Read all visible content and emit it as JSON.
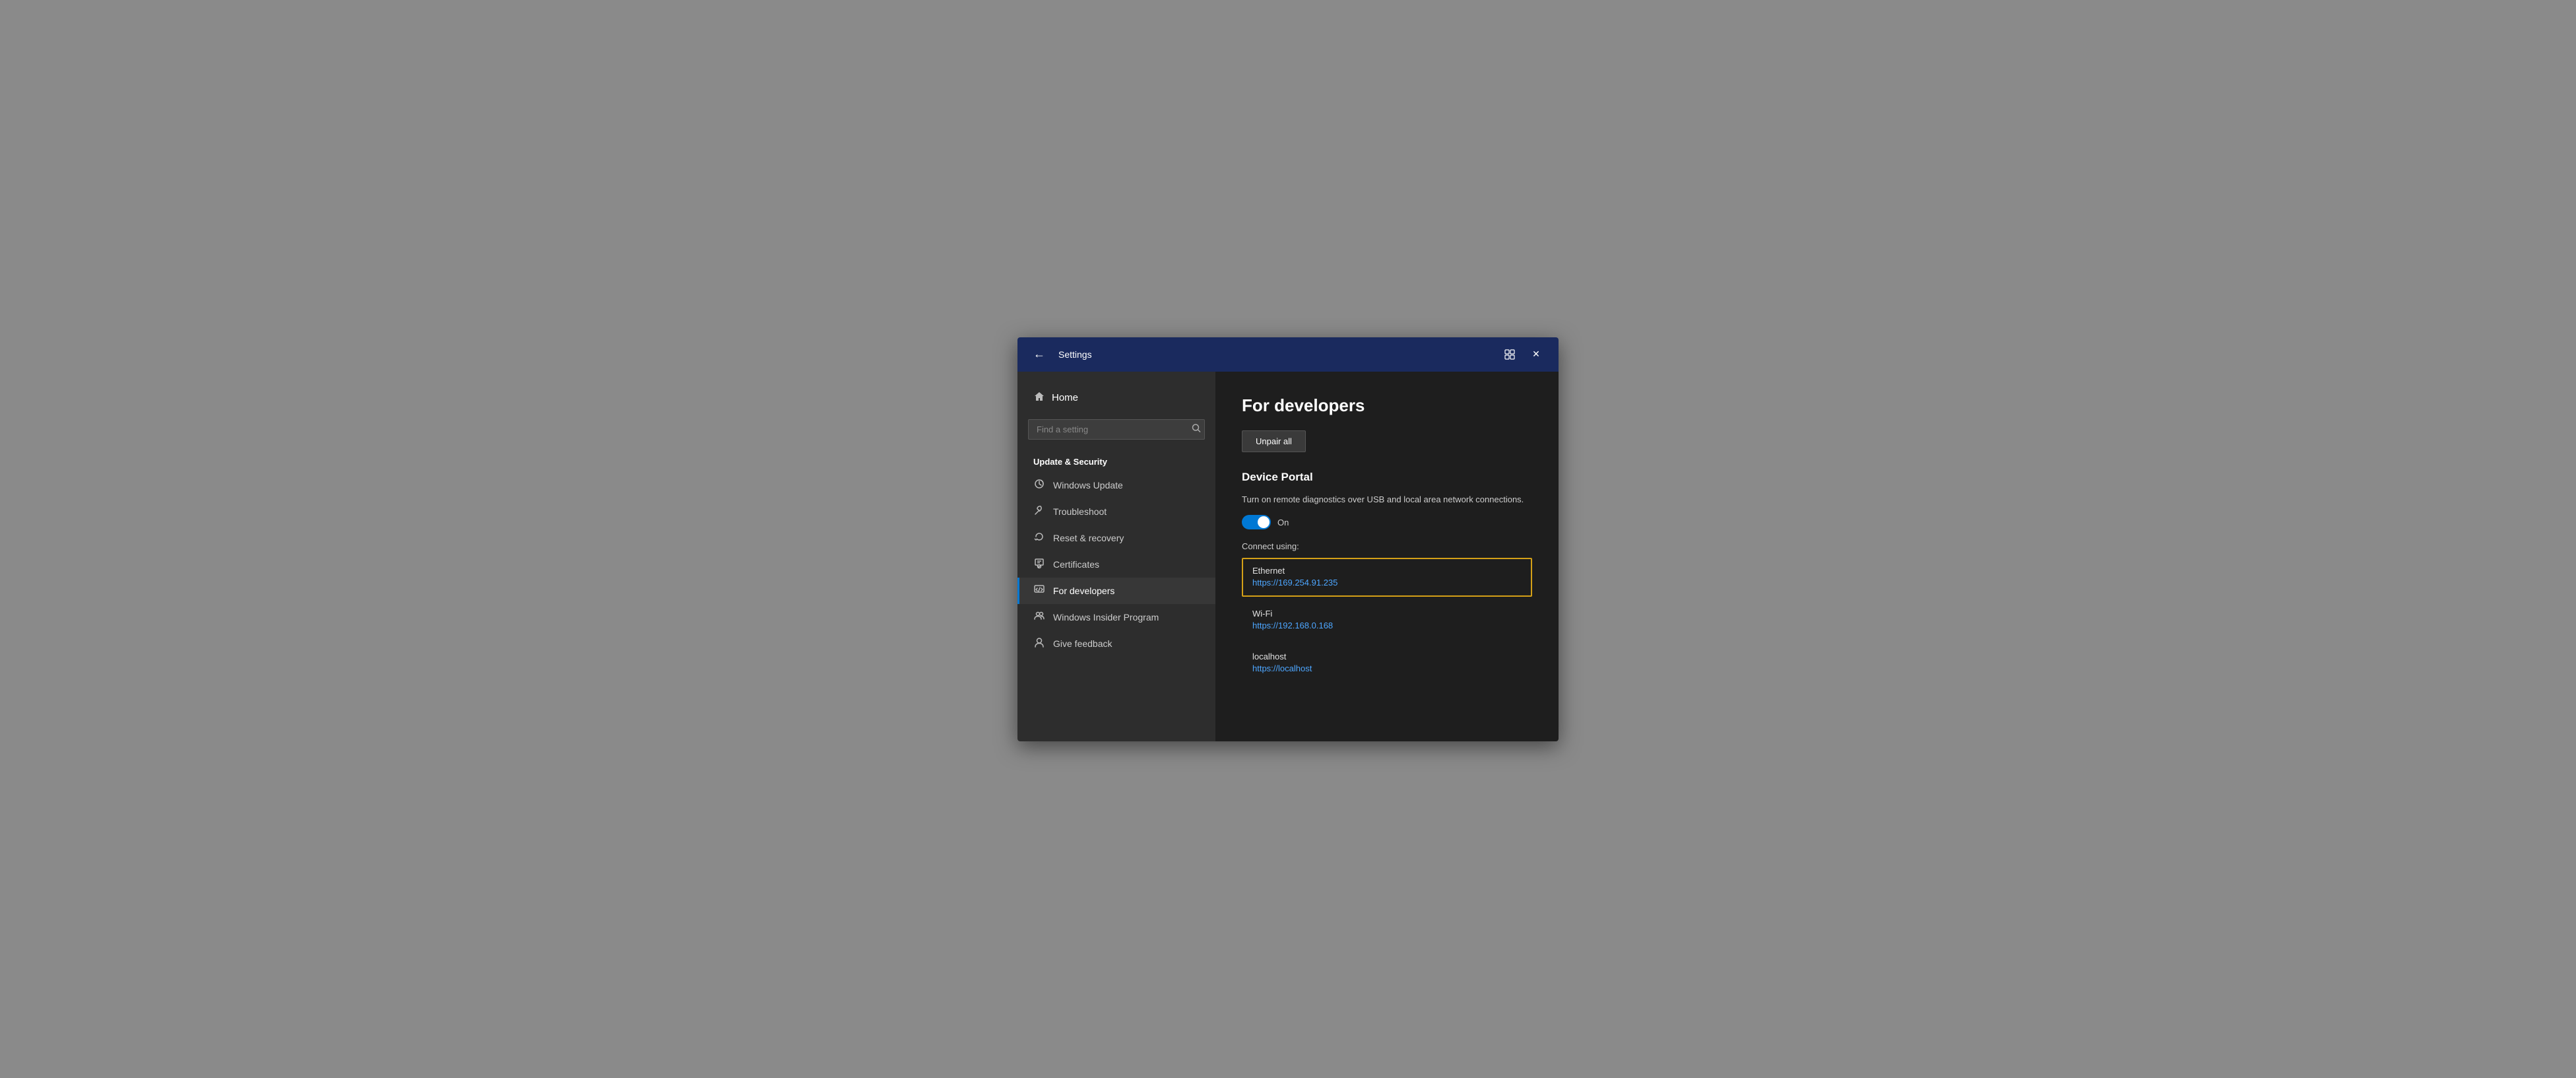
{
  "titlebar": {
    "back_label": "←",
    "title": "Settings",
    "snap_icon": "⊞",
    "close_icon": "✕"
  },
  "sidebar": {
    "home_label": "Home",
    "search_placeholder": "Find a setting",
    "section_label": "Update & Security",
    "items": [
      {
        "id": "windows-update",
        "label": "Windows Update",
        "icon": "↻"
      },
      {
        "id": "troubleshoot",
        "label": "Troubleshoot",
        "icon": "🔧"
      },
      {
        "id": "reset-recovery",
        "label": "Reset & recovery",
        "icon": "↺"
      },
      {
        "id": "certificates",
        "label": "Certificates",
        "icon": "🏷"
      },
      {
        "id": "for-developers",
        "label": "For developers",
        "icon": "⊞",
        "active": true
      },
      {
        "id": "windows-insider",
        "label": "Windows Insider Program",
        "icon": "👥"
      },
      {
        "id": "give-feedback",
        "label": "Give feedback",
        "icon": "👤"
      }
    ]
  },
  "main": {
    "title": "For developers",
    "unpair_button": "Unpair all",
    "device_portal": {
      "title": "Device Portal",
      "description": "Turn on remote diagnostics over USB and local area network connections.",
      "toggle_state": "On",
      "connect_label": "Connect using:",
      "connections": [
        {
          "id": "ethernet",
          "name": "Ethernet",
          "url": "https://169.254.91.235",
          "selected": true
        },
        {
          "id": "wifi",
          "name": "Wi-Fi",
          "url": "https://192.168.0.168",
          "selected": false
        },
        {
          "id": "localhost",
          "name": "localhost",
          "url": "https://localhost",
          "selected": false
        }
      ]
    }
  }
}
